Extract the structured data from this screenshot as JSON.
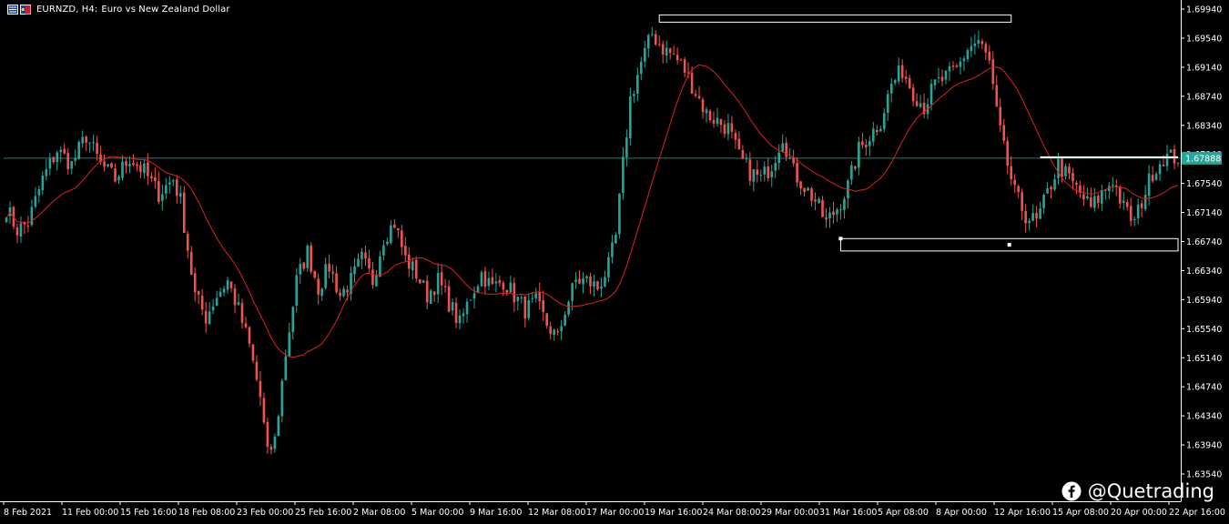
{
  "header": {
    "symbol": "EURNZD, H4:",
    "description": "Euro vs New Zealand Dollar"
  },
  "watermark": {
    "text": "@Quetrading",
    "icon": "facebook-icon"
  },
  "colors": {
    "background": "#000000",
    "bull": "#26a69a",
    "bear": "#ef5350",
    "ma": "#e02020",
    "axis": "#ffffff",
    "price_line": "#2a7a70",
    "current_price_bg": "#26a69a",
    "zone": "#ffffff"
  },
  "chart_data": {
    "type": "candlestick",
    "symbol": "EURNZD",
    "timeframe": "H4",
    "title": "Euro vs New Zealand Dollar",
    "ylim": [
      1.6335,
      1.6994
    ],
    "y_ticks": [
      1.6994,
      1.6954,
      1.6914,
      1.6874,
      1.6834,
      1.6794,
      1.6754,
      1.6714,
      1.6674,
      1.6634,
      1.6594,
      1.6554,
      1.6514,
      1.6474,
      1.6434,
      1.6394,
      1.6354
    ],
    "y_tick_labels": [
      "1.69940",
      "1.69540",
      "1.69140",
      "1.68740",
      "1.68340",
      "1.67940",
      "1.67540",
      "1.67140",
      "1.66740",
      "1.66340",
      "1.65940",
      "1.65540",
      "1.65140",
      "1.64740",
      "1.64340",
      "1.63940",
      "1.63540"
    ],
    "x_tick_labels": [
      "8 Feb 2021",
      "11 Feb 00:00",
      "15 Feb 16:00",
      "18 Feb 08:00",
      "23 Feb 00:00",
      "25 Feb 16:00",
      "2 Mar 08:00",
      "5 Mar 00:00",
      "9 Mar 16:00",
      "12 Mar 08:00",
      "17 Mar 00:00",
      "19 Mar 16:00",
      "24 Mar 08:00",
      "29 Mar 00:00",
      "31 Mar 16:00",
      "5 Apr 08:00",
      "8 Apr 00:00",
      "12 Apr 16:00",
      "15 Apr 08:00",
      "20 Apr 00:00",
      "22 Apr 16:00"
    ],
    "current_price": 1.67888,
    "current_price_label": "1.67888",
    "moving_average": {
      "type": "SMA",
      "color": "#e02020"
    },
    "close_path": [
      [
        0,
        1.672
      ],
      [
        3,
        1.669
      ],
      [
        6,
        1.67
      ],
      [
        10,
        1.676
      ],
      [
        14,
        1.68
      ],
      [
        18,
        1.678
      ],
      [
        22,
        1.682
      ],
      [
        26,
        1.678
      ],
      [
        30,
        1.676
      ],
      [
        34,
        1.679
      ],
      [
        38,
        1.677
      ],
      [
        42,
        1.674
      ],
      [
        46,
        1.676
      ],
      [
        48,
        1.673
      ],
      [
        52,
        1.66
      ],
      [
        55,
        1.657
      ],
      [
        58,
        1.66
      ],
      [
        61,
        1.662
      ],
      [
        64,
        1.658
      ],
      [
        67,
        1.653
      ],
      [
        70,
        1.646
      ],
      [
        72,
        1.638
      ],
      [
        74,
        1.64
      ],
      [
        77,
        1.652
      ],
      [
        80,
        1.662
      ],
      [
        83,
        1.666
      ],
      [
        86,
        1.661
      ],
      [
        89,
        1.664
      ],
      [
        92,
        1.66
      ],
      [
        95,
        1.662
      ],
      [
        98,
        1.665
      ],
      [
        101,
        1.662
      ],
      [
        104,
        1.668
      ],
      [
        107,
        1.67
      ],
      [
        110,
        1.665
      ],
      [
        113,
        1.663
      ],
      [
        116,
        1.66
      ],
      [
        119,
        1.662
      ],
      [
        122,
        1.659
      ],
      [
        125,
        1.656
      ],
      [
        128,
        1.66
      ],
      [
        131,
        1.663
      ],
      [
        134,
        1.661
      ],
      [
        137,
        1.662
      ],
      [
        140,
        1.66
      ],
      [
        143,
        1.658
      ],
      [
        146,
        1.659
      ],
      [
        149,
        1.656
      ],
      [
        152,
        1.654
      ],
      [
        154,
        1.658
      ],
      [
        157,
        1.662
      ],
      [
        160,
        1.662
      ],
      [
        163,
        1.661
      ],
      [
        166,
        1.664
      ],
      [
        168,
        1.668
      ],
      [
        170,
        1.678
      ],
      [
        172,
        1.687
      ],
      [
        175,
        1.692
      ],
      [
        178,
        1.696
      ],
      [
        181,
        1.694
      ],
      [
        184,
        1.693
      ],
      [
        187,
        1.691
      ],
      [
        190,
        1.688
      ],
      [
        193,
        1.685
      ],
      [
        196,
        1.684
      ],
      [
        199,
        1.683
      ],
      [
        202,
        1.679
      ],
      [
        205,
        1.677
      ],
      [
        208,
        1.676
      ],
      [
        211,
        1.678
      ],
      [
        214,
        1.682
      ],
      [
        217,
        1.677
      ],
      [
        220,
        1.675
      ],
      [
        223,
        1.673
      ],
      [
        226,
        1.67
      ],
      [
        229,
        1.672
      ],
      [
        232,
        1.675
      ],
      [
        235,
        1.68
      ],
      [
        238,
        1.682
      ],
      [
        241,
        1.684
      ],
      [
        244,
        1.689
      ],
      [
        247,
        1.691
      ],
      [
        250,
        1.688
      ],
      [
        253,
        1.686
      ],
      [
        256,
        1.689
      ],
      [
        259,
        1.69
      ],
      [
        262,
        1.691
      ],
      [
        265,
        1.694
      ],
      [
        268,
        1.695
      ],
      [
        271,
        1.692
      ],
      [
        273,
        1.685
      ],
      [
        275,
        1.68
      ],
      [
        278,
        1.674
      ],
      [
        281,
        1.671
      ],
      [
        284,
        1.67
      ],
      [
        287,
        1.674
      ],
      [
        290,
        1.678
      ],
      [
        293,
        1.676
      ],
      [
        296,
        1.674
      ],
      [
        299,
        1.672
      ],
      [
        302,
        1.674
      ],
      [
        305,
        1.676
      ],
      [
        308,
        1.672
      ],
      [
        311,
        1.67
      ],
      [
        313,
        1.673
      ],
      [
        316,
        1.677
      ],
      [
        319,
        1.679
      ]
    ],
    "annotations": [
      {
        "type": "rectangle",
        "label": "resistance-zone",
        "time_from": 180,
        "time_to": 277,
        "price_from": 1.6976,
        "price_to": 1.6986
      },
      {
        "type": "rectangle",
        "label": "support-zone",
        "time_from": 230,
        "time_to": 323,
        "price_from": 1.6661,
        "price_to": 1.6678
      },
      {
        "type": "segment",
        "label": "horizontal-level",
        "time_from": 285,
        "time_to": 323,
        "price": 1.679
      }
    ]
  }
}
